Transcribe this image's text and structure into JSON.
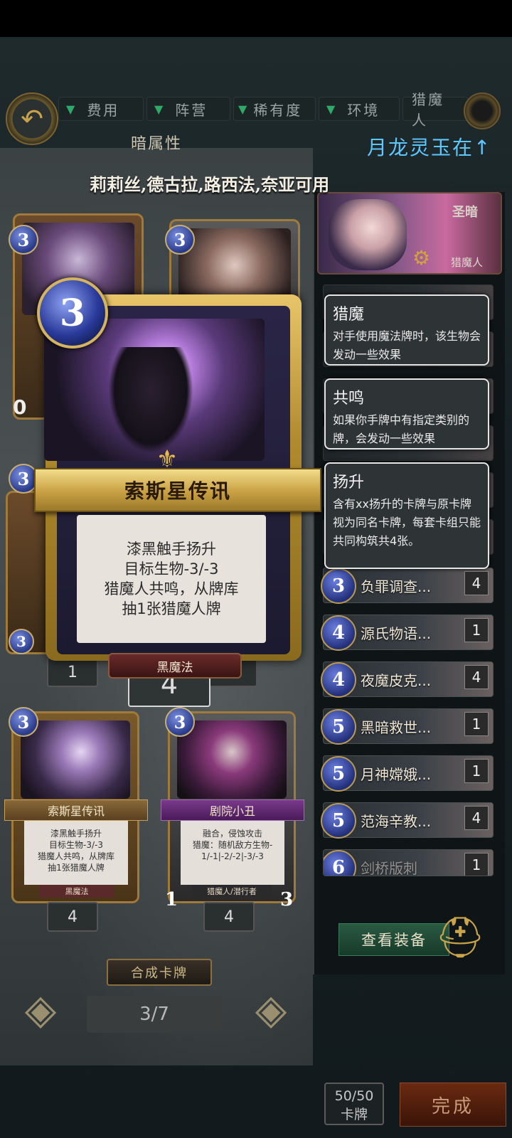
{
  "filters": {
    "cost": "费用",
    "camp": "阵营",
    "rarity": "稀有度",
    "environment": "环境",
    "race": "猎魔人"
  },
  "attribute_header": "暗属性",
  "marquee": "月龙灵玉在↑",
  "usable_heroes": "莉莉丝,德古拉,路西法,奈亚可用",
  "grid_cards": {
    "c1": {
      "cost": "3",
      "count": "0"
    },
    "c2": {
      "cost": "3"
    },
    "c3": {
      "cost": "3"
    },
    "c4": {
      "cost": "3"
    },
    "row2_counts": [
      "1",
      "4"
    ],
    "c5": {
      "cost": "3",
      "name": "索斯星传讯",
      "text": "漆黑触手扬升\n目标生物-3/-3\n猎魔人共鸣，从牌库\n抽1张猎魔人牌",
      "type": "黑魔法",
      "count": "4"
    },
    "c6": {
      "cost": "3",
      "name": "剧院小丑",
      "text": "融合，侵蚀攻击\n猎魔：随机敌方生物-\n1/-1|-2/-2|-3/-3",
      "type": "猎魔人/潜行者",
      "attack": "1",
      "health": "3",
      "count": "4"
    }
  },
  "big_card": {
    "cost": "3",
    "name": "索斯星传讯",
    "text": "漆黑触手扬升\n目标生物-3/-3\n猎魔人共鸣，从牌库\n抽1张猎魔人牌",
    "type": "黑魔法",
    "selected_count": "4"
  },
  "hero": {
    "faction": "圣暗",
    "label": "猎魔人"
  },
  "tooltips": [
    {
      "title": "猎魔",
      "body": "对手使用魔法牌时，该生物会发动一些效果"
    },
    {
      "title": "共鸣",
      "body": "如果你手牌中有指定类别的牌，会发动一些效果"
    },
    {
      "title": "扬升",
      "body": "含有xx扬升的卡牌与原卡牌视为同名卡牌，每套卡组只能共同构筑共4张。"
    }
  ],
  "deck_list": [
    {
      "cost": "3",
      "name": "负罪调查...",
      "qty": "4"
    },
    {
      "cost": "4",
      "name": "源氏物语...",
      "qty": "1"
    },
    {
      "cost": "4",
      "name": "夜魔皮克...",
      "qty": "4"
    },
    {
      "cost": "5",
      "name": "黑暗救世...",
      "qty": "1"
    },
    {
      "cost": "5",
      "name": "月神嫦娥...",
      "qty": "1"
    },
    {
      "cost": "5",
      "name": "范海辛教...",
      "qty": "4"
    },
    {
      "cost": "6",
      "name": "剑桥版刺",
      "qty": "1"
    }
  ],
  "view_equipment": "查看装备",
  "compose_button": "合成卡牌",
  "page_indicator": "3/7",
  "deck_count": {
    "value": "50/50",
    "label": "卡牌"
  },
  "done_button": "完成",
  "colors": {
    "accent_gold": "#c9a043",
    "marquee_blue": "#5fc7ff",
    "filter_green": "#2fa86a"
  }
}
